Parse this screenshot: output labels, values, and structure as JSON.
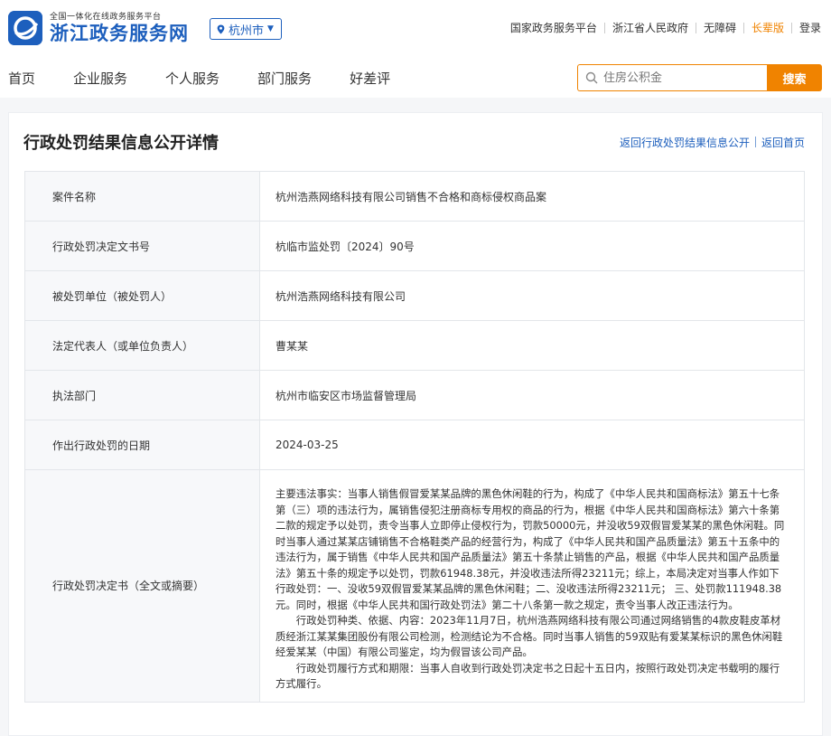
{
  "header": {
    "logo_sub": "全国一体化在线政务服务平台",
    "logo_main": "浙江政务服务网",
    "city": "杭州市",
    "top_links": [
      "国家政务服务平台",
      "浙江省人民政府",
      "无障碍",
      "长辈版",
      "登录"
    ],
    "nav": [
      "首页",
      "企业服务",
      "个人服务",
      "部门服务",
      "好差评"
    ],
    "search_placeholder": "住房公积金",
    "search_button": "搜索"
  },
  "page": {
    "title": "行政处罚结果信息公开详情",
    "link_back_list": "返回行政处罚结果信息公开",
    "link_home": "返回首页"
  },
  "rows": [
    {
      "label": "案件名称",
      "value": "杭州浩燕网络科技有限公司销售不合格和商标侵权商品案"
    },
    {
      "label": "行政处罚决定文书号",
      "value": "杭临市监处罚〔2024〕90号"
    },
    {
      "label": "被处罚单位（被处罚人）",
      "value": "杭州浩燕网络科技有限公司"
    },
    {
      "label": "法定代表人（或单位负责人）",
      "value": "曹某某"
    },
    {
      "label": "执法部门",
      "value": "杭州市临安区市场监督管理局"
    },
    {
      "label": "作出行政处罚的日期",
      "value": "2024-03-25"
    }
  ],
  "decision": {
    "label": "行政处罚决定书（全文或摘要）",
    "p1": "主要违法事实：当事人销售假冒爱某某品牌的黑色休闲鞋的行为，构成了《中华人民共和国商标法》第五十七条第（三）项的违法行为，属销售侵犯注册商标专用权的商品的行为，根据《中华人民共和国商标法》第六十条第二款的规定予以处罚，责令当事人立即停止侵权行为，罚款50000元，并没收59双假冒爱某某的黑色休闲鞋。同时当事人通过某某店铺销售不合格鞋类产品的经营行为，构成了《中华人民共和国产品质量法》第五十五条中的违法行为，属于销售《中华人民共和国产品质量法》第五十条禁止销售的产品，根据《中华人民共和国产品质量法》第五十条的规定予以处罚，罚款61948.38元，并没收违法所得23211元；综上，本局决定对当事人作如下行政处罚：一、没收59双假冒爱某某品牌的黑色休闲鞋；二、没收违法所得23211元； 三、处罚款111948.38元。同时，根据《中华人民共和国行政处罚法》第二十八条第一款之规定，责令当事人改正违法行为。",
    "p2": "行政处罚种类、依据、内容：2023年11月7日，杭州浩燕网络科技有限公司通过网络销售的4款皮鞋皮革材质经浙江某某集团股份有限公司检测，检测结论为不合格。同时当事人销售的59双贴有爱某某标识的黑色休闲鞋经爱某某（中国）有限公司鉴定，均为假冒该公司产品。",
    "p3": "行政处罚履行方式和期限：当事人自收到行政处罚决定书之日起十五日内，按照行政处罚决定书载明的履行方式履行。"
  },
  "colors": {
    "brand": "#1d5fbd",
    "accent": "#f08300"
  }
}
